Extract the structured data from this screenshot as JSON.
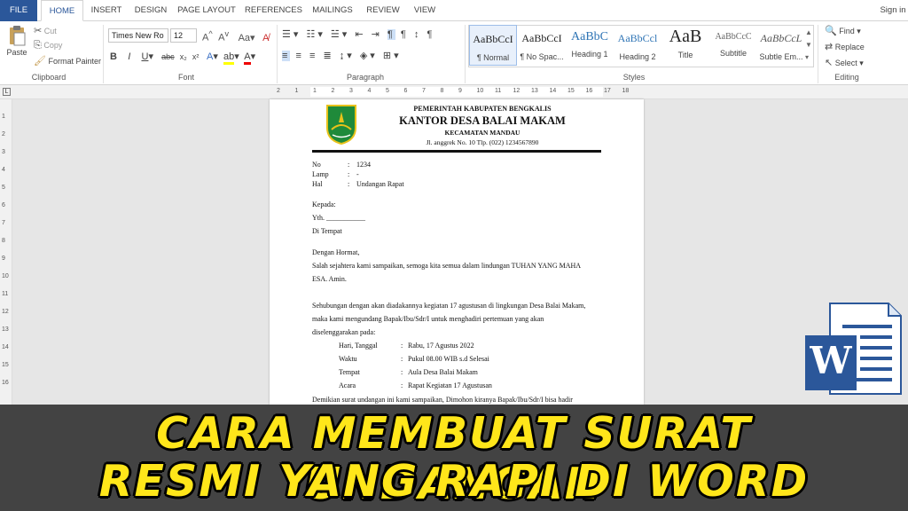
{
  "tabs": [
    "FILE",
    "HOME",
    "INSERT",
    "DESIGN",
    "PAGE LAYOUT",
    "REFERENCES",
    "MAILINGS",
    "REVIEW",
    "VIEW"
  ],
  "sign_in": "Sign in",
  "clipboard": {
    "paste": "Paste",
    "cut": "Cut",
    "copy": "Copy",
    "format_painter": "Format Painter",
    "label": "Clipboard"
  },
  "font": {
    "name": "Times New Ro",
    "size": "12",
    "label": "Font"
  },
  "paragraph": {
    "label": "Paragraph"
  },
  "styles": {
    "items": [
      {
        "sample": "AaBbCcI",
        "name": "¶ Normal"
      },
      {
        "sample": "AaBbCcI",
        "name": "¶ No Spac..."
      },
      {
        "sample": "AaBbC",
        "name": "Heading 1"
      },
      {
        "sample": "AaBbCcl",
        "name": "Heading 2"
      },
      {
        "sample": "AaB",
        "name": "Title"
      },
      {
        "sample": "AaBbCcC",
        "name": "Subtitle"
      },
      {
        "sample": "AaBbCcL",
        "name": "Subtle Em..."
      }
    ],
    "label": "Styles"
  },
  "editing": {
    "find": "Find",
    "replace": "Replace",
    "select": "Select",
    "label": "Editing"
  },
  "ruler": [
    "2",
    "1",
    "1",
    "2",
    "3",
    "4",
    "5",
    "6",
    "7",
    "8",
    "9",
    "10",
    "11",
    "12",
    "13",
    "14",
    "15",
    "16",
    "17",
    "18"
  ],
  "vruler": [
    "1",
    "2",
    "3",
    "4",
    "5",
    "6",
    "7",
    "8",
    "9",
    "10",
    "11",
    "12",
    "13",
    "14",
    "15",
    "16"
  ],
  "letterhead": {
    "line1": "PEMERINTAH KABUPATEN BENGKALIS",
    "line2": "KANTOR DESA BALAI MAKAM",
    "line3": "KECAMATAN MANDAU",
    "line4": "Jl. anggrek No. 10 Tlp. (022) 1234567890"
  },
  "meta": [
    {
      "key": "No",
      "sep": ":",
      "value": "1234"
    },
    {
      "key": "Lamp",
      "sep": ":",
      "value": "-"
    },
    {
      "key": "Hal",
      "sep": ":",
      "value": "Undangan Rapat"
    }
  ],
  "recipient": {
    "kepada": "Kepada:",
    "yth": "Yth. ___________",
    "tempat": "Di Tempat"
  },
  "body": {
    "salam": "Dengan Hormat,",
    "p1_l1": "Salah sejahtera kami sampaikan, semoga kita semua dalam lindungan TUHAN YANG MAHA",
    "p1_l2": "ESA. Amin.",
    "p2_l1": "Sehubungan dengan akan diadakannya kegiatan 17 agustusan di lingkungan Desa Balai Makam,",
    "p2_l2": "maka kami mengundang Bapak/Ibu/Sdr/I untuk menghadiri pertemuan yang akan",
    "p2_l3": "diselenggarakan pada:",
    "closing": "Demikian surat undangan ini kami sampaikan, Dimohon kiranya Bapak/Ibu/Sdr/I bisa hadir"
  },
  "details": [
    {
      "key": "Hari, Tanggal",
      "sep": ":",
      "value": "Rabu, 17 Agustus 2022"
    },
    {
      "key": "Waktu",
      "sep": ":",
      "value": "Pukul 08.00 WIB s.d Selesai"
    },
    {
      "key": "Tempat",
      "sep": ":",
      "value": "Aula Desa Balai Makam"
    },
    {
      "key": "Acara",
      "sep": ":",
      "value": "Rapat Kegiatan 17 Agustusan"
    }
  ],
  "banner": {
    "line1": "CARA MEMBUAT SURAT UNDANGAN",
    "line2": "RESMI YANG RAPI DI WORD"
  },
  "word_logo_letter": "W",
  "colors": {
    "accent": "#2b579a",
    "banner_bg": "#434343",
    "banner_text": "#ffe61a",
    "logo_green": "#1f8a3a"
  }
}
